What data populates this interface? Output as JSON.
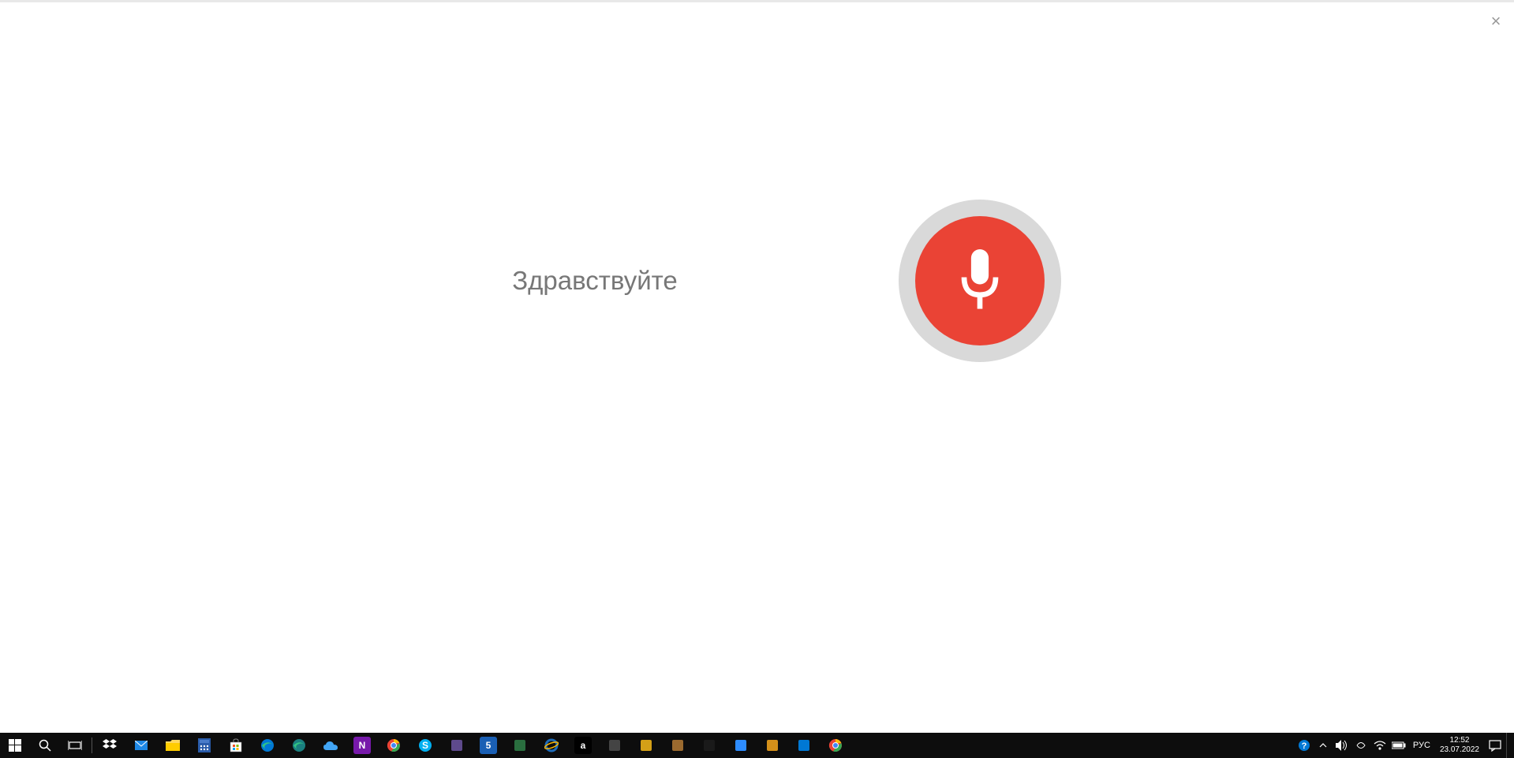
{
  "voice_search": {
    "prompt": "Здравствуйте"
  },
  "taskbar": {
    "system_tray": {
      "language": "РУС",
      "time": "12:52",
      "date": "23.07.2022"
    },
    "apps": [
      {
        "name": "dropbox",
        "bg": "#000",
        "text": "",
        "svg_type": "dropbox"
      },
      {
        "name": "mail",
        "bg": "#0078d4",
        "text": "",
        "svg_type": "mail"
      },
      {
        "name": "file-explorer",
        "bg": "#ffcc00",
        "text": "",
        "svg_type": "folder"
      },
      {
        "name": "calculator",
        "bg": "#2a5caa",
        "text": "",
        "svg_type": "calc"
      },
      {
        "name": "microsoft-store",
        "bg": "#fff",
        "text": "",
        "svg_type": "store"
      },
      {
        "name": "edge",
        "bg": "#0078d4",
        "text": "",
        "svg_type": "edge"
      },
      {
        "name": "edge-dev",
        "bg": "#1a7f7f",
        "text": "",
        "svg_type": "edge"
      },
      {
        "name": "cloud-app",
        "bg": "#0078d4",
        "text": "",
        "svg_type": "cloud"
      },
      {
        "name": "onenote",
        "bg": "#7719aa",
        "text": "N",
        "svg_type": "text"
      },
      {
        "name": "chrome",
        "bg": "#333",
        "text": "",
        "svg_type": "chrome"
      },
      {
        "name": "skype",
        "bg": "#00aff0",
        "text": "S",
        "svg_type": "skype"
      },
      {
        "name": "app1",
        "bg": "#5e4a8c",
        "text": "",
        "svg_type": "generic"
      },
      {
        "name": "app2",
        "bg": "#1a5fb4",
        "text": "5",
        "svg_type": "text"
      },
      {
        "name": "app3",
        "bg": "#2a6e3f",
        "text": "",
        "svg_type": "generic"
      },
      {
        "name": "internet-explorer",
        "bg": "#1e6bb8",
        "text": "e",
        "svg_type": "ie"
      },
      {
        "name": "amazon",
        "bg": "#000",
        "text": "a",
        "svg_type": "text"
      },
      {
        "name": "app4",
        "bg": "#444",
        "text": "",
        "svg_type": "generic"
      },
      {
        "name": "app5",
        "bg": "#d4a017",
        "text": "",
        "svg_type": "generic"
      },
      {
        "name": "app6",
        "bg": "#9b6a2f",
        "text": "",
        "svg_type": "generic"
      },
      {
        "name": "app7",
        "bg": "#1a1a1a",
        "text": "",
        "svg_type": "generic"
      },
      {
        "name": "app8",
        "bg": "#2d8cff",
        "text": "",
        "svg_type": "generic"
      },
      {
        "name": "app9",
        "bg": "#d4901a",
        "text": "",
        "svg_type": "generic"
      },
      {
        "name": "app10",
        "bg": "#0078d4",
        "text": "",
        "svg_type": "generic"
      },
      {
        "name": "chrome2",
        "bg": "#333",
        "text": "",
        "svg_type": "chrome"
      }
    ]
  }
}
